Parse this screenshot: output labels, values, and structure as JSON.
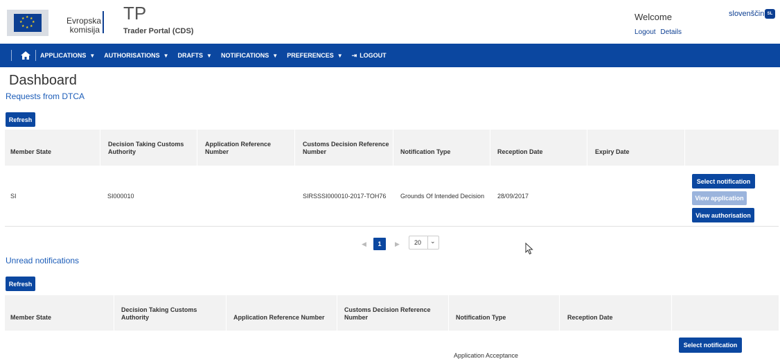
{
  "header": {
    "logo_line1": "Evropska",
    "logo_line2": "komisija",
    "app_abbr": "TP",
    "app_name": "Trader Portal (CDS)",
    "welcome": "Welcome",
    "language": "slovenščina",
    "lang_badge": "SL",
    "logout": "Logout",
    "details": "Details"
  },
  "nav": {
    "items": [
      "APPLICATIONS",
      "AUTHORISATIONS",
      "DRAFTS",
      "NOTIFICATIONS",
      "PREFERENCES"
    ],
    "logout": "LOGOUT"
  },
  "page": {
    "title": "Dashboard"
  },
  "requests": {
    "title": "Requests from DTCA",
    "refresh": "Refresh",
    "columns": [
      "Member State",
      "Decision Taking Customs Authority",
      "Application Reference Number",
      "Customs Decision Reference Number",
      "Notification Type",
      "Reception Date",
      "Expiry Date"
    ],
    "rows": [
      {
        "member_state": "SI",
        "dtca": "SI000010",
        "app_ref": "",
        "cdr": "SIRSSSI000010-2017-TOH76",
        "type": "Grounds Of Intended Decision",
        "reception": "28/09/2017",
        "expiry": "",
        "actions": [
          "Select notification",
          "View application",
          "View authorisation"
        ]
      }
    ],
    "pager": {
      "page": "1",
      "page_size": "20"
    }
  },
  "unread": {
    "title": "Unread notifications",
    "refresh": "Refresh",
    "columns": [
      "Member State",
      "Decision Taking Customs Authority",
      "Application Reference Number",
      "Customs Decision Reference Number",
      "Notification Type",
      "Reception Date"
    ],
    "row_action": "Select notification",
    "row_type_partial": "Application Acceptance"
  }
}
